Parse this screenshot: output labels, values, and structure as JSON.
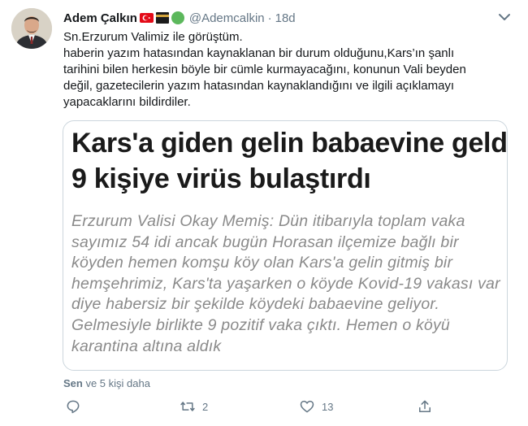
{
  "tweet": {
    "author_name": "Adem Çalkın",
    "handle": "@Ademcalkin",
    "separator": "·",
    "time": "18d",
    "text_lines": [
      "Sn.Erzurum Valimiz ile görüştüm.",
      "haberin yazım hatasından kaynaklanan bir durum olduğunu,Kars’ın şanlı",
      "tarihini bilen herkesin böyle bir cümle kurmayacağını, konunun Vali beyden",
      "değil, gazetecilerin yazım hatasından kaynaklandığını ve ilgili açıklamayı",
      "yapacaklarını bildirdiler."
    ]
  },
  "card": {
    "headline_lines": [
      "Kars'a giden gelin babaevine geldi,",
      "9 kişiye virüs bulaştırdı"
    ],
    "quote_lines": [
      "Erzurum Valisi Okay Memiş: Dün itibarıyla toplam vaka",
      "sayımız 54 idi ancak bugün Horasan ilçemize bağlı bir",
      "köyden hemen komşu köy olan Kars'a gelin gitmiş bir",
      "hemşehrimiz, Kars'ta yaşarken o köyde Kovid-19 vakası var",
      "diye habersiz bir şekilde köydeki babaevine geliyor.",
      "Gelmesiyle birlikte 9 pozitif vaka çıktı. Hemen o köyü",
      "karantina altına aldık"
    ]
  },
  "likers": {
    "bold": "Sen",
    "rest": " ve 5 kişi daha"
  },
  "actions": {
    "reply": {
      "icon": "reply-icon",
      "count": ""
    },
    "retweet": {
      "icon": "retweet-icon",
      "count": "2"
    },
    "like": {
      "icon": "heart-icon",
      "count": "13"
    },
    "share": {
      "icon": "share-icon",
      "count": ""
    }
  },
  "colors": {
    "secondary_text": "#657786",
    "border": "#ccd6dd",
    "quote_text": "#8a8a8a"
  }
}
